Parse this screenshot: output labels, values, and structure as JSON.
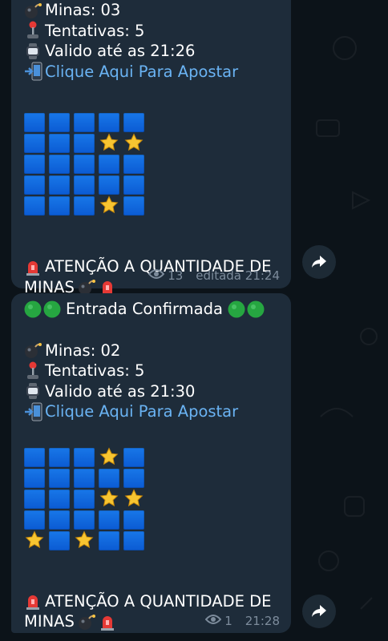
{
  "messages": [
    {
      "header": "",
      "mines_label": "Minas: 03",
      "attempts_label": "Tentativas: 5",
      "valid_label": "Valido até as 21:26",
      "link_label": "Clique Aqui Para Apostar",
      "board": [
        [
          "blue",
          "blue",
          "blue",
          "blue",
          "blue"
        ],
        [
          "blue",
          "blue",
          "blue",
          "star",
          "star"
        ],
        [
          "blue",
          "blue",
          "blue",
          "blue",
          "blue"
        ],
        [
          "blue",
          "blue",
          "blue",
          "blue",
          "blue"
        ],
        [
          "blue",
          "blue",
          "blue",
          "star",
          "blue"
        ]
      ],
      "warning_line1": "ATENÇÃO A QUANTIDADE DE",
      "warning_line2": "MINAS",
      "views": "13",
      "status": "editada 21:24"
    },
    {
      "header": "Entrada Confirmada",
      "mines_label": "Minas: 02",
      "attempts_label": "Tentativas: 5",
      "valid_label": "Valido até as 21:30",
      "link_label": "Clique Aqui Para Apostar",
      "board": [
        [
          "blue",
          "blue",
          "blue",
          "star",
          "blue"
        ],
        [
          "blue",
          "blue",
          "blue",
          "blue",
          "blue"
        ],
        [
          "blue",
          "blue",
          "blue",
          "star",
          "star"
        ],
        [
          "blue",
          "blue",
          "blue",
          "blue",
          "blue"
        ],
        [
          "star",
          "blue",
          "star",
          "blue",
          "blue"
        ]
      ],
      "warning_line1": "ATENÇÃO A QUANTIDADE DE",
      "warning_line2": "MINAS",
      "views": "1",
      "status": "21:28"
    }
  ],
  "icons": {
    "bomb": "bomb-icon",
    "joystick": "joystick-icon",
    "watch": "watch-icon",
    "phone": "mobile-arrow-icon",
    "siren": "siren-icon",
    "green_circle": "green-circle-icon",
    "star": "star-icon",
    "eye": "eye-icon",
    "share": "share-arrow-icon"
  },
  "colors": {
    "background": "#0c1319",
    "bubble": "#1e2c3a",
    "link": "#6ab3f3",
    "tile_blue": "#1672e4",
    "meta_text": "#7d8c9c"
  }
}
